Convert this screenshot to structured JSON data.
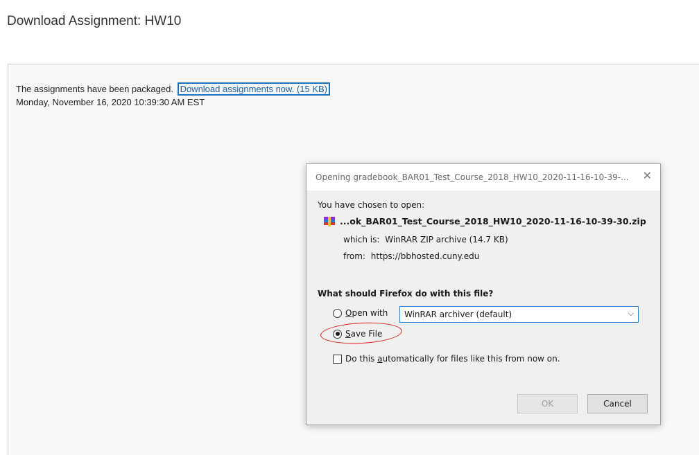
{
  "page": {
    "title": "Download Assignment: HW10",
    "status_text": "The assignments have been packaged.",
    "download_link": "Download assignments now. (15 KB)",
    "timestamp": "Monday, November 16, 2020 10:39:30 AM EST"
  },
  "dialog": {
    "title": "Opening gradebook_BAR01_Test_Course_2018_HW10_2020-11-16-10-39-...",
    "close_glyph": "✕",
    "chosen_label": "You have chosen to open:",
    "file_name": "...ok_BAR01_Test_Course_2018_HW10_2020-11-16-10-39-30.zip",
    "which_is_label": "which is:",
    "which_is_value": "WinRAR ZIP archive (14.7 KB)",
    "from_label": "from:",
    "from_value": "https://bbhosted.cuny.edu",
    "question": "What should Firefox do with this file?",
    "open_with_label": "Open with",
    "open_with_selected": false,
    "app_select_value": "WinRAR archiver (default)",
    "chevron_glyph": "⌵",
    "save_file_label": "Save File",
    "save_file_selected": true,
    "auto_checkbox_prefix": "Do this ",
    "auto_checkbox_accel": "a",
    "auto_checkbox_suffix": "utomatically for files like this from now on.",
    "auto_checkbox_checked": false,
    "ok_label": "OK",
    "cancel_label": "Cancel",
    "ok_disabled": true
  },
  "colors": {
    "link": "#1a5fa8",
    "focus_border": "#1a73c9",
    "annotation": "#e01b1b",
    "dialog_bg": "#f0f0f0"
  },
  "icons": {
    "file_icon": "winrar-archive-icon",
    "close_icon": "close-icon",
    "dropdown_icon": "chevron-down-icon"
  }
}
